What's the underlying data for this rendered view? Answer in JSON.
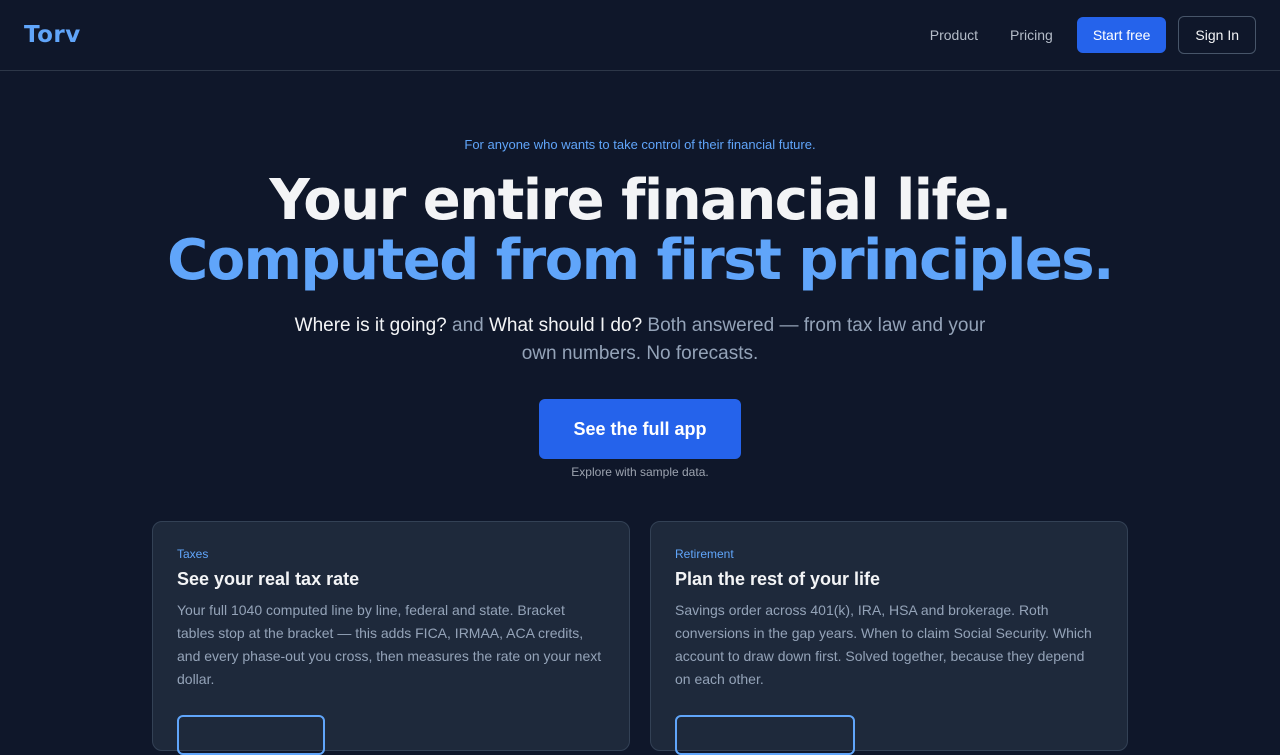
{
  "nav": {
    "logo": "Torv",
    "links": [
      "Product",
      "Pricing"
    ],
    "start_label": "Start free",
    "signin_label": "Sign In"
  },
  "hero": {
    "eyebrow": "For anyone who wants to take control of their financial future.",
    "title_line1": "Your entire financial life.",
    "title_line2": "Computed from first principles.",
    "sub_q1": "Where is it going?",
    "sub_and": " and ",
    "sub_q2": "What should I do?",
    "sub_rest": " Both answered — from tax law and your own numbers. No forecasts.",
    "cta_label": "See the full app",
    "cta_note": "Explore with sample data."
  },
  "cards": [
    {
      "tag": "Taxes",
      "title": "See your real tax rate",
      "body": "Your full 1040 computed line by line, federal and state. Bracket tables stop at the bracket — this adds FICA, IRMAA, ACA credits, and every phase-out you cross, then measures the rate on your next dollar."
    },
    {
      "tag": "Retirement",
      "title": "Plan the rest of your life",
      "body": "Savings order across 401(k), IRA, HSA and brokerage. Roth conversions in the gap years. When to claim Social Security. Which account to draw down first. Solved together, because they depend on each other."
    }
  ],
  "colors": {
    "background": "#0f172a",
    "accent": "#60a5fa",
    "primary": "#2563eb",
    "card": "#1e293b"
  }
}
